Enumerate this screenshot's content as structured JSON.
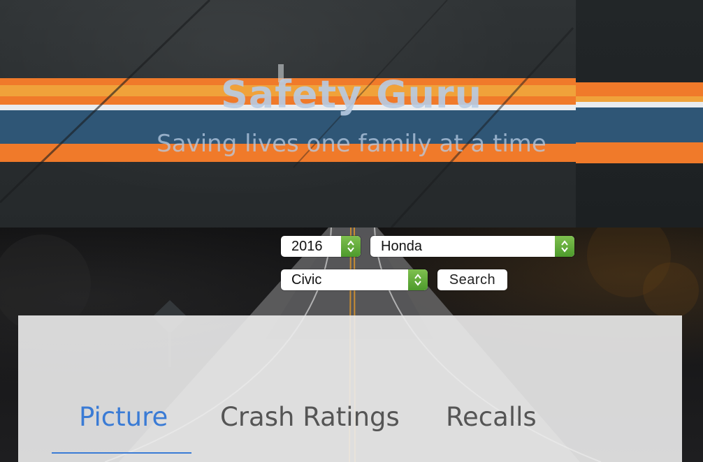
{
  "hero": {
    "title": "Safety Guru",
    "subtitle": "Saving lives one family at a time"
  },
  "search_form": {
    "year_select": {
      "value": "2016"
    },
    "make_select": {
      "value": "Honda"
    },
    "model_select": {
      "value": "Civic"
    },
    "search_label": "Search"
  },
  "tabs": [
    {
      "label": "Picture",
      "active": true
    },
    {
      "label": "Crash Ratings",
      "active": false
    },
    {
      "label": "Recalls",
      "active": false
    }
  ],
  "colors": {
    "accent": "#3a7bd5",
    "stepper_green": "#5faa36",
    "hero_text": "#b8cce4",
    "stripe_orange": "#f07a2a",
    "stripe_blue": "#2f5676"
  }
}
